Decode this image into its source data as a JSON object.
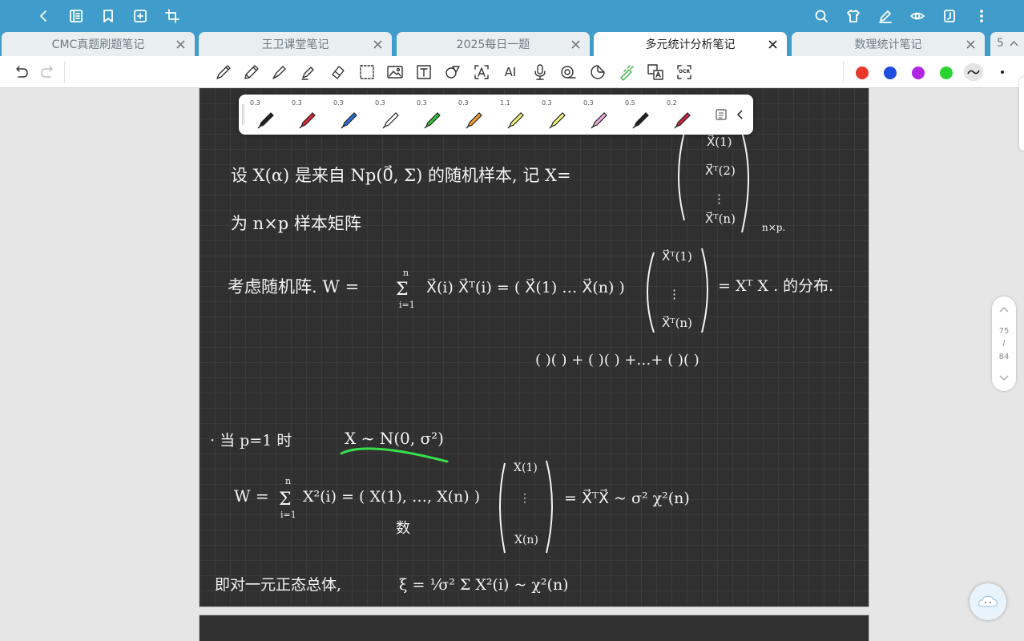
{
  "topbar": {
    "left_icons": [
      "back-icon",
      "notebook-icon",
      "bookmark-icon",
      "add-page-icon",
      "crop-icon"
    ],
    "right_icons": [
      "search-icon",
      "shirt-icon",
      "pen-settings-icon",
      "eye-icon",
      "page-view-icon",
      "more-icon"
    ]
  },
  "tabs": [
    {
      "title": "CMC真题刷题笔记",
      "active": false
    },
    {
      "title": "王卫课堂笔记",
      "active": false
    },
    {
      "title": "2025每日一题",
      "active": false
    },
    {
      "title": "多元统计分析笔记",
      "active": true
    },
    {
      "title": "数理统计笔记",
      "active": false
    }
  ],
  "tab_overflow": {
    "label": "5"
  },
  "toolbar": {
    "history": [
      "undo-icon",
      "redo-icon"
    ],
    "tools": [
      "ballpoint-pen-icon",
      "pencil-icon",
      "fountain-pen-icon",
      "highlighter-icon",
      "eraser-icon",
      "lasso-select-icon",
      "image-icon",
      "text-box-icon",
      "shapes-icon",
      "text-recognize-icon",
      "ai-icon",
      "microphone-icon",
      "tape-icon",
      "sticker-icon",
      "laser-pointer-icon",
      "translate-icon",
      "ocr-icon"
    ],
    "ai_label": "AI",
    "ocr_label": "OCR",
    "colors": [
      "#e8362b",
      "#1e4fe0",
      "#b028e6",
      "#2ad430"
    ]
  },
  "pens": [
    {
      "size": "0.3",
      "color": "#222222"
    },
    {
      "size": "0.3",
      "color": "#d8283a"
    },
    {
      "size": "0.3",
      "color": "#2a6fd6"
    },
    {
      "size": "0.3",
      "color": "#ffffff"
    },
    {
      "size": "0.3",
      "color": "#33c233"
    },
    {
      "size": "0.3",
      "color": "#f0a030"
    },
    {
      "size": "1.1",
      "color": "#f2f07a"
    },
    {
      "size": "0.3",
      "color": "#f2f07a"
    },
    {
      "size": "0.3",
      "color": "#f0a8d8"
    },
    {
      "size": "0.5",
      "color": "#222222"
    },
    {
      "size": "0.2",
      "color": "#c8283a"
    }
  ],
  "notes": {
    "l1a": "设 X(α) 是来自 Np(0⃗, Σ) 的随机样本, 记 X=",
    "m1a": "X⃗(1)",
    "m1b": "X⃗ᵀ(2)",
    "m1c": "⋮",
    "m1d": "X⃗ᵀ(n)",
    "m1e": "n×p.",
    "l2": "为 n×p 样本矩阵",
    "l3a": "考虑随机阵. W =",
    "l3sum": "Σ",
    "l3n": "n",
    "l3i": "i=1",
    "l3b": "X⃗(i) X⃗ᵀ(i) = ( X⃗(1) … X⃗(n) )",
    "m2a": "X⃗ᵀ(1)",
    "m2b": "⋮",
    "m2c": "X⃗ᵀ(n)",
    "l3c": "= Xᵀ X . 的分布.",
    "l4": "( )(  ) + ( )( ) +…+ ( )( )",
    "l5a": "· 当 p=1 时",
    "l5b": "X ~ N(0, σ²)",
    "l6a": "W =",
    "l6sum": "Σ",
    "l6n": "n",
    "l6i": "i=1",
    "l6b": "X²(i) = ( X(1), …, X(n) )",
    "m3a": "X(1)",
    "m3b": "⋮",
    "m3c": "X(n)",
    "l6c": "= X⃗ᵀX⃗ ~ σ² χ²(n)",
    "l6d": "数",
    "l7a": "即对一元正态总体,",
    "l7b": "ξ = ¹⁄σ² Σ X²(i) ~ χ²(n)"
  },
  "page_indicator": {
    "current": "75",
    "separator": "/",
    "total": "84"
  }
}
